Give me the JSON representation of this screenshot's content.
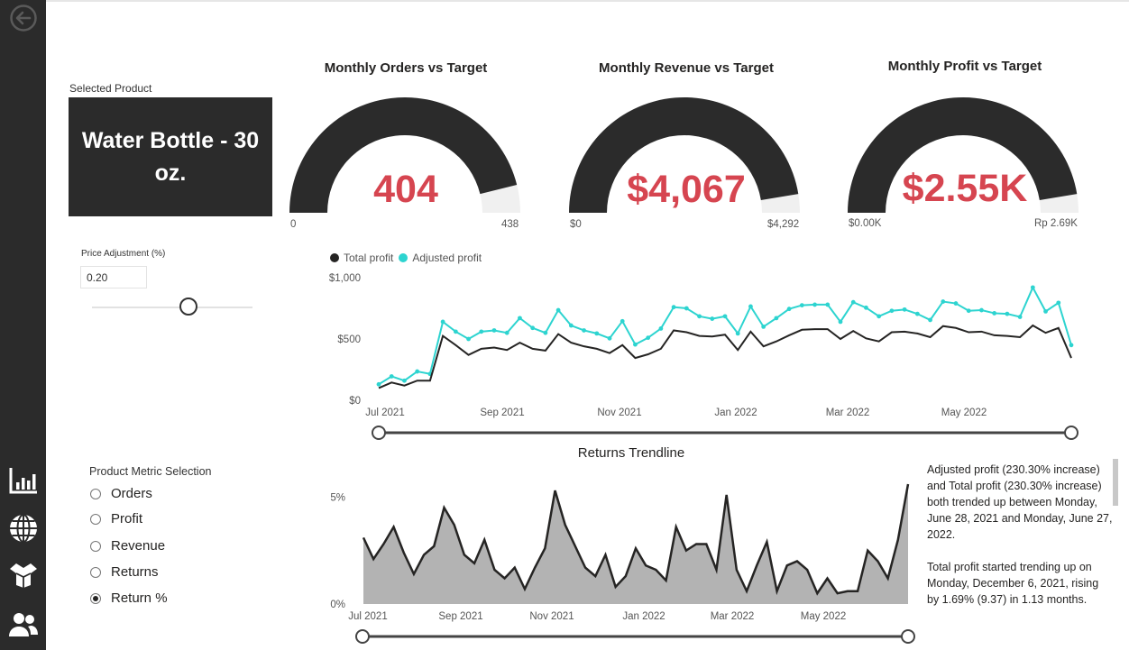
{
  "sidebar": {
    "items": [
      {
        "icon": "back-arrow-icon"
      },
      {
        "icon": "bar-chart-icon"
      },
      {
        "icon": "globe-icon"
      },
      {
        "icon": "box-icon"
      },
      {
        "icon": "people-icon"
      }
    ]
  },
  "selected_product": {
    "label": "Selected Product",
    "name": "Water Bottle - 30 oz."
  },
  "gauges": [
    {
      "title": "Monthly Orders vs Target",
      "value_text": "404",
      "min_label": "0",
      "max_label": "438",
      "fill_fraction": 0.922
    },
    {
      "title": "Monthly Revenue vs Target",
      "value_text": "$4,067",
      "min_label": "$0",
      "max_label": "$4,292",
      "fill_fraction": 0.948
    },
    {
      "title": "Monthly Profit vs Target",
      "value_text": "$2.55K",
      "min_label": "$0.00K",
      "max_label": "Rp 2.69K",
      "fill_fraction": 0.948
    }
  ],
  "price_adjustment": {
    "label": "Price Adjustment (%)",
    "value": "0.20",
    "slider_fraction": 0.6
  },
  "profit_legend": {
    "total": "Total profit",
    "adjusted": "Adjusted profit"
  },
  "returns_title": "Returns Trendline",
  "metric_selection": {
    "title": "Product Metric Selection",
    "options": [
      "Orders",
      "Profit",
      "Revenue",
      "Returns",
      "Return %"
    ],
    "selected": "Return %"
  },
  "insights": {
    "p1": "Adjusted profit (230.30% increase) and Total profit (230.30% increase) both trended up between Monday, June 28, 2021 and Monday, June 27, 2022.",
    "p2": "Total profit started trending up on Monday, December 6, 2021, rising by 1.69% (9.37) in 1.13 months."
  },
  "colors": {
    "sidebar": "#2b2b2b",
    "gauge_fill": "#2b2b2b",
    "gauge_track": "#f0f0f0",
    "kpi_value": "#d64550",
    "adjusted_profit": "#2dd4d0",
    "total_profit": "#252423",
    "returns_area": "#b3b3b3"
  },
  "chart_data": [
    {
      "type": "line",
      "x_unit": "week",
      "x_start": "2021-06-28",
      "x_end": "2022-06-27",
      "x_tick_labels": [
        "Jul 2021",
        "Sep 2021",
        "Nov 2021",
        "Jan 2022",
        "Mar 2022",
        "May 2022"
      ],
      "y_tick_labels": [
        "$0",
        "$500",
        "$1,000"
      ],
      "ylim": [
        0,
        1000
      ],
      "grid": false,
      "legend": "top-left",
      "series": [
        {
          "name": "Total profit",
          "values": [
            100,
            145,
            120,
            160,
            160,
            525,
            450,
            370,
            420,
            430,
            410,
            470,
            420,
            405,
            540,
            470,
            440,
            420,
            385,
            450,
            345,
            375,
            420,
            570,
            555,
            525,
            520,
            535,
            410,
            560,
            440,
            480,
            530,
            575,
            580,
            580,
            500,
            565,
            505,
            480,
            555,
            560,
            545,
            515,
            605,
            590,
            555,
            560,
            530,
            525,
            515,
            610,
            550,
            590,
            345
          ]
        },
        {
          "name": "Adjusted profit",
          "values": [
            130,
            195,
            160,
            235,
            215,
            640,
            560,
            500,
            560,
            570,
            550,
            670,
            590,
            550,
            735,
            610,
            570,
            545,
            505,
            645,
            455,
            510,
            585,
            760,
            750,
            685,
            665,
            685,
            545,
            765,
            600,
            670,
            745,
            775,
            780,
            780,
            640,
            800,
            755,
            685,
            730,
            740,
            705,
            655,
            805,
            790,
            730,
            735,
            710,
            705,
            680,
            920,
            725,
            795,
            450
          ]
        }
      ]
    },
    {
      "type": "area",
      "x_unit": "week",
      "x_start": "2021-06-28",
      "x_end": "2022-06-27",
      "x_tick_labels": [
        "Jul 2021",
        "Sep 2021",
        "Nov 2021",
        "Jan 2022",
        "Mar 2022",
        "May 2022"
      ],
      "y_tick_labels": [
        "0%",
        "5%"
      ],
      "ylim": [
        0,
        5.6
      ],
      "grid": false,
      "series": [
        {
          "name": "Return %",
          "values": [
            3.1,
            2.1,
            2.8,
            3.6,
            2.4,
            1.4,
            2.3,
            2.7,
            4.5,
            3.7,
            2.3,
            1.9,
            3.0,
            1.6,
            1.2,
            1.7,
            0.7,
            1.7,
            2.6,
            5.3,
            3.7,
            2.7,
            1.7,
            1.3,
            2.3,
            0.8,
            1.3,
            2.6,
            1.8,
            1.6,
            1.1,
            3.6,
            2.5,
            2.8,
            2.8,
            1.6,
            5.1,
            1.6,
            0.6,
            1.8,
            2.9,
            0.6,
            1.8,
            2.0,
            1.6,
            0.5,
            1.2,
            0.5,
            0.6,
            0.6,
            2.5,
            2.0,
            1.2,
            3.0,
            5.6
          ]
        }
      ]
    }
  ]
}
